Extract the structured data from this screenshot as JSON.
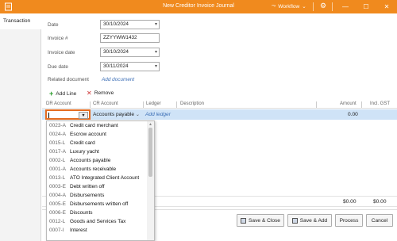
{
  "window": {
    "title": "New Creditor Invoice Journal",
    "workflow_label": "Workflow"
  },
  "tabs": [
    {
      "label": "Transaction"
    }
  ],
  "form": {
    "date": {
      "label": "Date",
      "value": "30/10/2024"
    },
    "invoice_no": {
      "label": "Invoice #",
      "value": "ZZYYWW1432"
    },
    "invoice_date": {
      "label": "Invoice date",
      "value": "30/10/2024"
    },
    "due_date": {
      "label": "Due date",
      "value": "30/11/2024"
    },
    "related_document": {
      "label": "Related document",
      "link": "Add document"
    }
  },
  "toolbar": {
    "add_line": "Add Line",
    "remove": "Remove"
  },
  "grid": {
    "headers": [
      "DR Account",
      "CR Account",
      "Ledger",
      "Description",
      "Amount",
      "Incl. GST"
    ],
    "row": {
      "dr_account": "",
      "cr_account": "Accounts payable",
      "ledger_link": "Add ledger",
      "amount": "0.00"
    }
  },
  "dropdown": {
    "items": [
      {
        "code": "0023-A",
        "name": "Credit card merchant"
      },
      {
        "code": "0024-A",
        "name": "Escrow account"
      },
      {
        "code": "0015-L",
        "name": "Credit card"
      },
      {
        "code": "0017-A",
        "name": "Luxury yacht"
      },
      {
        "code": "0002-L",
        "name": "Accounts payable"
      },
      {
        "code": "0001-A",
        "name": "Accounts receivable"
      },
      {
        "code": "0013-L",
        "name": "ATO Integrated Client Account"
      },
      {
        "code": "0003-E",
        "name": "Debt written off"
      },
      {
        "code": "0004-A",
        "name": "Disbursements"
      },
      {
        "code": "0005-E",
        "name": "Disbursements written off"
      },
      {
        "code": "0006-E",
        "name": "Discounts"
      },
      {
        "code": "0012-L",
        "name": "Goods and Services Tax"
      },
      {
        "code": "0007-I",
        "name": "Interest"
      }
    ]
  },
  "totals": {
    "amount": "$0.00",
    "incl_gst": "$0.00"
  },
  "footer": {
    "save_close": "Save & Close",
    "save_add": "Save & Add",
    "process": "Process",
    "cancel": "Cancel"
  },
  "colors": {
    "titlebar": "#f08a1e",
    "selected_row": "#cfe3f7",
    "focus_border": "#e46b1f",
    "link": "#3d6fb6"
  }
}
